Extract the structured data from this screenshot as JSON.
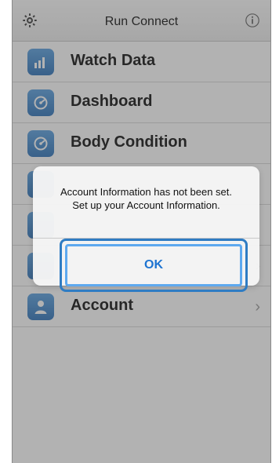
{
  "header": {
    "title": "Run Connect",
    "settings_icon": "gear-icon",
    "info_icon": "info-icon"
  },
  "menu": {
    "items": [
      {
        "label": "Watch Data",
        "icon": "bar-chart-icon"
      },
      {
        "label": "Dashboard",
        "icon": "dashboard-icon"
      },
      {
        "label": "Body Condition",
        "icon": "dashboard-icon"
      },
      {
        "label": "",
        "icon": "blue-tile-icon"
      },
      {
        "label": "",
        "icon": "blue-tile-icon"
      },
      {
        "label": "",
        "icon": "blue-tile-icon"
      },
      {
        "label": "Account",
        "icon": "person-icon"
      }
    ]
  },
  "alert": {
    "message_line1": "Account Information has not been set.",
    "message_line2": "Set up your Account Information.",
    "ok_label": "OK"
  },
  "colors": {
    "accent": "#2F7CC3",
    "menu_icon": "#3F85C9",
    "ok_text": "#1E74D1"
  }
}
